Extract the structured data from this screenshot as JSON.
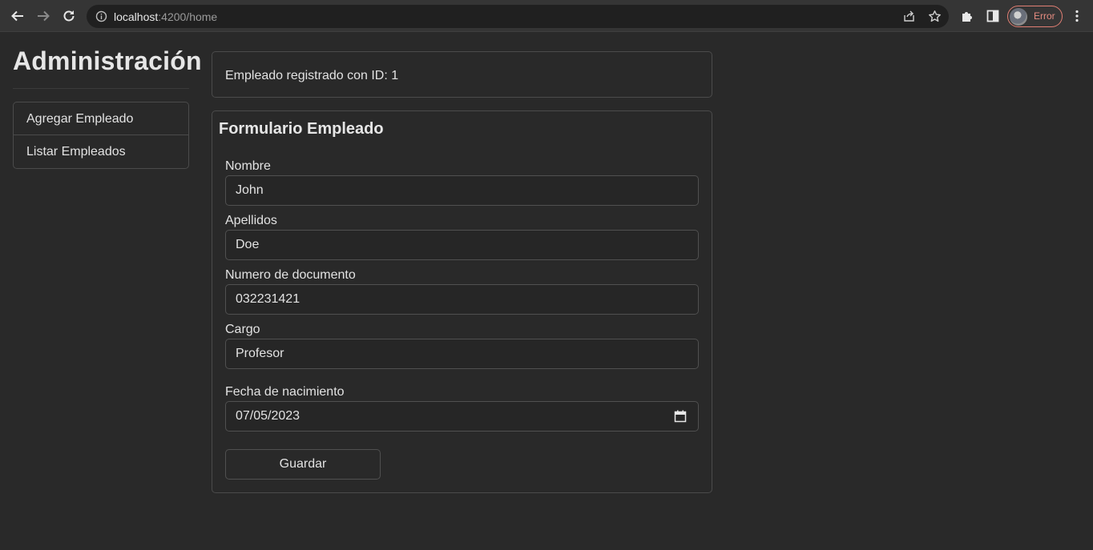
{
  "browser": {
    "url_host": "localhost",
    "url_path": ":4200/home",
    "profile_label": "Error",
    "colors": {
      "profile_accent": "#e17f74",
      "chrome_bg": "#353535",
      "page_bg": "#292929"
    },
    "icons": [
      "back-arrow-icon",
      "forward-arrow-icon",
      "reload-icon",
      "site-info-icon",
      "share-icon",
      "star-icon",
      "extensions-icon",
      "side-panel-icon",
      "menu-icon"
    ]
  },
  "sidebar": {
    "title": "Administración",
    "items": [
      {
        "label": "Agregar Empleado"
      },
      {
        "label": "Listar Empleados"
      }
    ]
  },
  "alert": {
    "message": "Empleado registrado con ID: 1"
  },
  "form": {
    "title": "Formulario Empleado",
    "fields": [
      {
        "label": "Nombre",
        "value": "John"
      },
      {
        "label": "Apellidos",
        "value": "Doe"
      },
      {
        "label": "Numero de documento",
        "value": "032231421"
      },
      {
        "label": "Cargo",
        "value": "Profesor"
      },
      {
        "label": "Fecha de nacimiento",
        "value": "07/05/2023"
      }
    ],
    "save_label": "Guardar"
  }
}
